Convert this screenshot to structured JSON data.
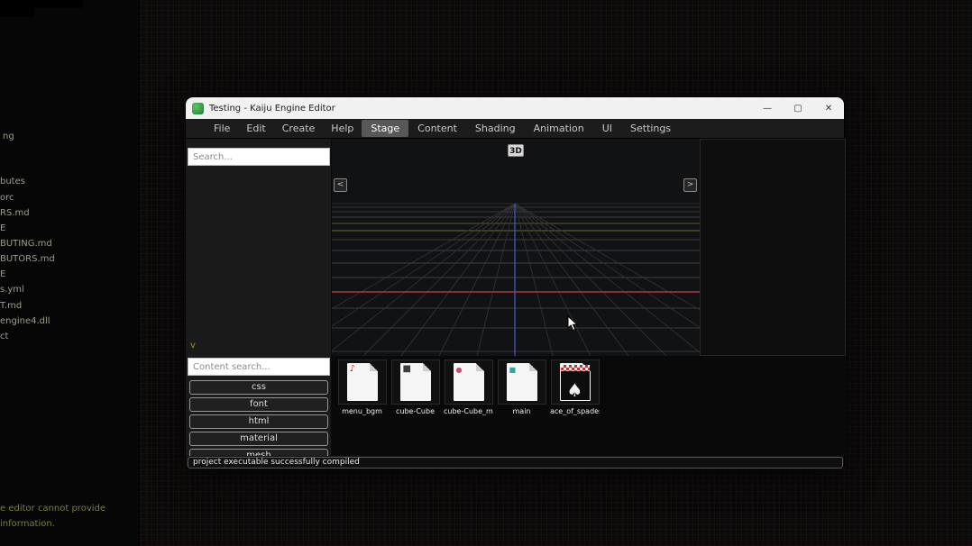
{
  "window": {
    "title": "Testing - Kaiju Engine Editor",
    "controls": {
      "minimize": "—",
      "maximize": "▢",
      "close": "✕"
    }
  },
  "menu": {
    "items": [
      "File",
      "Edit",
      "Create",
      "Help"
    ]
  },
  "tabs": {
    "items": [
      {
        "label": "Stage",
        "active": true
      },
      {
        "label": "Content",
        "active": false
      },
      {
        "label": "Shading",
        "active": false
      },
      {
        "label": "Animation",
        "active": false
      },
      {
        "label": "UI",
        "active": false
      },
      {
        "label": "Settings",
        "active": false
      }
    ]
  },
  "hierarchy": {
    "search_placeholder": "Search...",
    "collapse_indicator": "v"
  },
  "content_panel": {
    "search_placeholder": "Content search...",
    "filters": [
      "css",
      "font",
      "html",
      "material",
      "mesh"
    ]
  },
  "viewport": {
    "mode_label": "3D",
    "prev_label": "<",
    "next_label": ">",
    "axis_colors": {
      "x_axis": "#b03642",
      "z_axis": "#4a55c0"
    }
  },
  "assets": [
    {
      "name": "menu_bgm",
      "type": "audio",
      "glyph": "♪"
    },
    {
      "name": "cube-Cube",
      "type": "mesh",
      "glyph": "■"
    },
    {
      "name": "cube-Cube_mat",
      "type": "material",
      "glyph": "●"
    },
    {
      "name": "main",
      "type": "code",
      "glyph": "■"
    },
    {
      "name": "ace_of_spades",
      "type": "image",
      "glyph": "♠"
    }
  ],
  "status": {
    "message": "project executable successfully compiled"
  },
  "background": {
    "fragments": [
      "ng",
      "butes",
      "orc",
      "RS.md",
      "E",
      "BUTING.md",
      "BUTORS.md",
      "E",
      "s.yml",
      "T.md",
      "engine4.dll",
      "ct"
    ],
    "notes": [
      "e editor cannot provide",
      "information."
    ]
  }
}
